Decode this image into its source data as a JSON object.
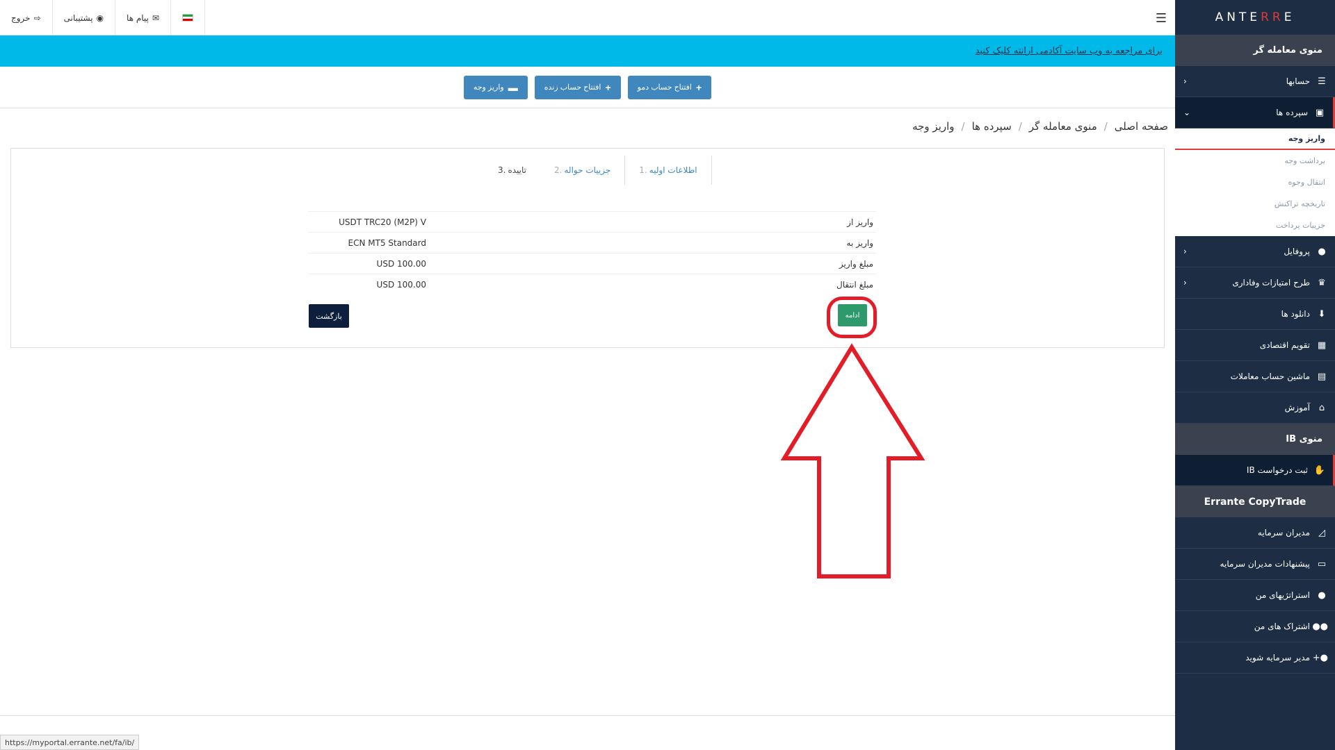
{
  "logo": {
    "pre": "E",
    "mid": "RR",
    "post": "ANTE"
  },
  "topbar": {
    "logout": "خروج",
    "support": "پشتیبانی",
    "messages": "پیام ها"
  },
  "notice": {
    "text": "برای مراجعه به وب سایت آکادمی ارانته کلیک کنید"
  },
  "buttons": {
    "demo": "افتتاح حساب دمو",
    "live": "افتتاح حساب زنده",
    "deposit": "واریز وجه"
  },
  "breadcrumb": [
    "صفحه اصلی",
    "منوی معامله گر",
    "سپرده ها",
    "واریز وجه"
  ],
  "steps": [
    {
      "label": "اطلاعات اولیه",
      "num": ".1"
    },
    {
      "label": "جزییات حواله",
      "num": ".2"
    },
    {
      "label": "تاییده",
      "num": ".3"
    }
  ],
  "details": [
    {
      "label": "واریز از",
      "value": "USDT TRC20 (M2P) V"
    },
    {
      "label": "واریز به",
      "value": "ECN MT5 Standard"
    },
    {
      "label": "مبلغ واریز",
      "value": "USD 100.00"
    },
    {
      "label": "مبلغ انتقال",
      "value": "USD 100.00"
    }
  ],
  "actions": {
    "back": "بازگشت",
    "continue": "ادامه"
  },
  "sidebar": {
    "trader_menu": "منوی معامله گر",
    "accounts": "حسابها",
    "deposits": "سپرده ها",
    "deposit_sub": [
      "واریز وجه",
      "برداشت وجه",
      "انتقال وجوه",
      "تاریخچه تراکنش",
      "جزییات پرداخت"
    ],
    "profile": "پروفایل",
    "loyalty": "طرح امتیازات وفاداری",
    "downloads": "دانلود ها",
    "calendar": "تقویم اقتصادی",
    "calculator": "ماشین حساب معاملات",
    "education": "آموزش",
    "ib_menu": "منوی IB",
    "ib_request": "ثبت درخواست IB",
    "copytrade": "Errante CopyTrade",
    "managers": "مدیران سرمایه",
    "manager_offers": "پیشنهادات مدیران سرمایه",
    "my_strategies": "استراتژیهای من",
    "my_subscriptions": "اشتراک های من",
    "become_manager": "مدیر سرمایه شوید"
  },
  "status_url": "https://myportal.errante.net/fa/ib/",
  "colors": {
    "sidebar": "#1d2e44",
    "notice": "#00b9e9",
    "accent": "#e03a3a",
    "button": "#3f87bd",
    "continue": "#2e9a6c"
  }
}
